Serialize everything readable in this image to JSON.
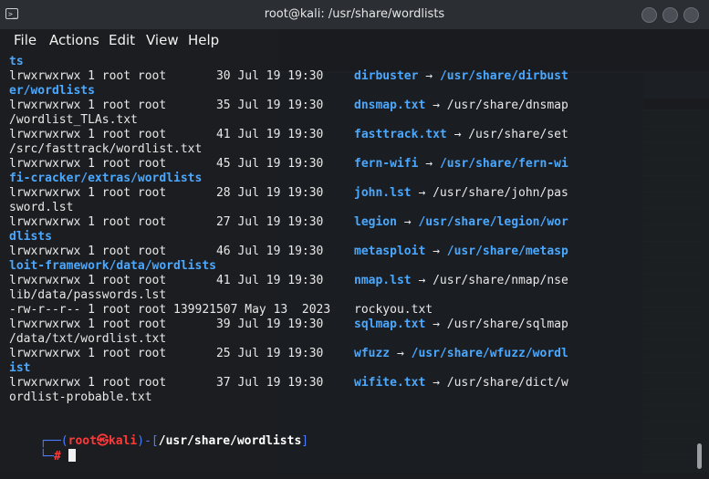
{
  "window": {
    "title": "root@kali: /usr/share/wordlists",
    "controls": [
      "minimize",
      "maximize",
      "close"
    ]
  },
  "menu": [
    "File",
    "Actions",
    "Edit",
    "View",
    "Help"
  ],
  "terminal": {
    "lines": [
      {
        "a": "",
        "b": "ts",
        "kind": "blue-only"
      },
      {
        "a": "lrwxrwxrwx 1 root root       30 Jul 19 19:30 ",
        "name": "dirbuster",
        "arrow": " → ",
        "target": "/usr/share/dirbust",
        "nameBlue": true,
        "targetBlue": true
      },
      {
        "a": "",
        "b": "er/wordlists",
        "kind": "blue-only"
      },
      {
        "a": "lrwxrwxrwx 1 root root       35 Jul 19 19:30 ",
        "name": "dnsmap.txt",
        "arrow": " → ",
        "target": "/usr/share/dnsmap",
        "nameBlue": true,
        "targetBlue": false
      },
      {
        "a": "",
        "b": "/wordlist_TLAs.txt",
        "kind": "white-only"
      },
      {
        "a": "lrwxrwxrwx 1 root root       41 Jul 19 19:30 ",
        "name": "fasttrack.txt",
        "arrow": " → ",
        "target": "/usr/share/set",
        "nameBlue": true,
        "targetBlue": false
      },
      {
        "a": "",
        "b": "/src/fasttrack/wordlist.txt",
        "kind": "white-only"
      },
      {
        "a": "lrwxrwxrwx 1 root root       45 Jul 19 19:30 ",
        "name": "fern-wifi",
        "arrow": " → ",
        "target": "/usr/share/fern-wi",
        "nameBlue": true,
        "targetBlue": true
      },
      {
        "a": "",
        "b": "fi-cracker/extras/wordlists",
        "kind": "blue-only"
      },
      {
        "a": "lrwxrwxrwx 1 root root       28 Jul 19 19:30 ",
        "name": "john.lst",
        "arrow": " → ",
        "target": "/usr/share/john/pas",
        "nameBlue": true,
        "targetBlue": false
      },
      {
        "a": "",
        "b": "sword.lst",
        "kind": "white-only"
      },
      {
        "a": "lrwxrwxrwx 1 root root       27 Jul 19 19:30 ",
        "name": "legion",
        "arrow": " → ",
        "target": "/usr/share/legion/wor",
        "nameBlue": true,
        "targetBlue": true
      },
      {
        "a": "",
        "b": "dlists",
        "kind": "blue-only"
      },
      {
        "a": "lrwxrwxrwx 1 root root       46 Jul 19 19:30 ",
        "name": "metasploit",
        "arrow": " → ",
        "target": "/usr/share/metasp",
        "nameBlue": true,
        "targetBlue": true
      },
      {
        "a": "",
        "b": "loit-framework/data/wordlists",
        "kind": "blue-only"
      },
      {
        "a": "lrwxrwxrwx 1 root root       41 Jul 19 19:30 ",
        "name": "nmap.lst",
        "arrow": " → ",
        "target": "/usr/share/nmap/nse",
        "nameBlue": true,
        "targetBlue": false
      },
      {
        "a": "",
        "b": "lib/data/passwords.lst",
        "kind": "white-only"
      },
      {
        "a": "-rw-r--r-- 1 root root 139921507 May 13  2023 ",
        "name": "rockyou.txt",
        "arrow": "",
        "target": "",
        "nameBlue": false,
        "targetBlue": false
      },
      {
        "a": "lrwxrwxrwx 1 root root       39 Jul 19 19:30 ",
        "name": "sqlmap.txt",
        "arrow": " → ",
        "target": "/usr/share/sqlmap",
        "nameBlue": true,
        "targetBlue": false
      },
      {
        "a": "",
        "b": "/data/txt/wordlist.txt",
        "kind": "white-only"
      },
      {
        "a": "lrwxrwxrwx 1 root root       25 Jul 19 19:30 ",
        "name": "wfuzz",
        "arrow": " → ",
        "target": "/usr/share/wfuzz/wordl",
        "nameBlue": true,
        "targetBlue": true
      },
      {
        "a": "",
        "b": "ist",
        "kind": "blue-only"
      },
      {
        "a": "lrwxrwxrwx 1 root root       37 Jul 19 19:30 ",
        "name": "wifite.txt",
        "arrow": " → ",
        "target": "/usr/share/dict/w",
        "nameBlue": true,
        "targetBlue": false
      },
      {
        "a": "",
        "b": "ordlist-probable.txt",
        "kind": "white-only"
      }
    ],
    "prompt": {
      "corner_top": "┌──(",
      "user": "root",
      "at": "㉿",
      "host": "kali",
      "mid": ")-[",
      "path": "/usr/share/wordlists",
      "end": "]",
      "corner_bottom": "└─",
      "symbol": "#"
    }
  },
  "colors": {
    "blue": "#4aa8ff",
    "prompt_blue": "#4b7cff",
    "prompt_red": "#ff3838",
    "text": "#e8e8e8"
  }
}
